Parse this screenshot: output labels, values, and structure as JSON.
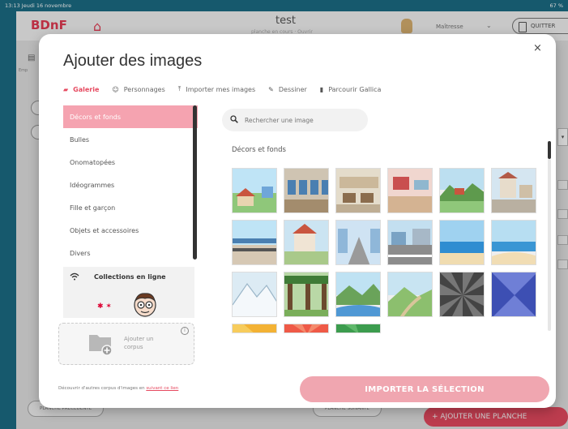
{
  "status_bar": {
    "left": "13:13  Jeudi 16 novembre",
    "right": "67 %"
  },
  "app": {
    "brand": "BDnF",
    "doc_title": "test",
    "doc_subtitle": "planche en cours · Ouvrir",
    "role": "Maîtresse",
    "quit_label": "QUITTER",
    "side_tool_label": "Emp",
    "prev_plate": "PLANCHE PRÉCÉDENTE",
    "next_plate": "PLANCHE SUIVANTE",
    "add_plate": "+  AJOUTER UNE PLANCHE"
  },
  "modal": {
    "title": "Ajouter des images",
    "close": "×",
    "tabs": [
      {
        "label": "Galerie",
        "icon": "book-icon"
      },
      {
        "label": "Personnages",
        "icon": "smile-icon"
      },
      {
        "label": "Importer mes images",
        "icon": "upload-icon"
      },
      {
        "label": "Dessiner",
        "icon": "pencil-icon"
      },
      {
        "label": "Parcourir Gallica",
        "icon": "gallica-icon"
      }
    ],
    "categories": [
      "Décors et fonds",
      "Bulles",
      "Onomatopées",
      "Idéogrammes",
      "Fille et garçon",
      "Objets et accessoires",
      "Divers"
    ],
    "online_collections": "Collections en ligne",
    "add_corpus": "Ajouter un corpus",
    "footer_note_prefix": "Découvrir d'autres corpus d'images en ",
    "footer_link": "suivant ce lien",
    "import_button": "IMPORTER LA SÉLECTION",
    "search_placeholder": "Rechercher une image",
    "section_title": "Décors et fonds"
  },
  "colors": {
    "accent": "#e64a60",
    "accent_light": "#f0a6b0",
    "teal_frame": "#1b6d86"
  }
}
